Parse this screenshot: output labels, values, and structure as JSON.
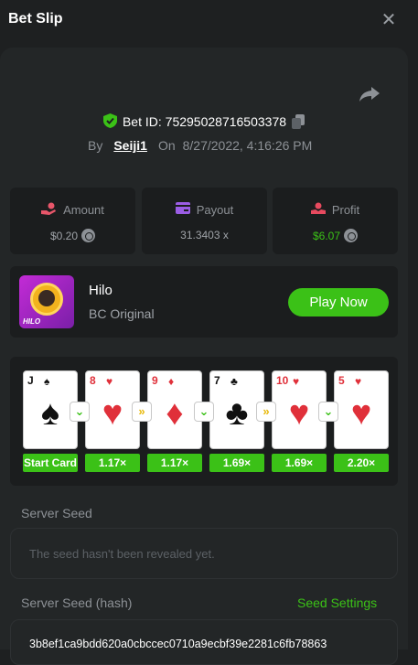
{
  "header": {
    "title": "Bet Slip",
    "close_glyph": "✕"
  },
  "bet": {
    "id_label": "Bet ID: 75295028716503378",
    "by_label": "By",
    "user": "Seiji1",
    "on_label": "On",
    "date": "8/27/2022, 4:16:26 PM"
  },
  "stats": {
    "amount": {
      "label": "Amount",
      "value": "$0.20",
      "icon": "hand-coins-icon",
      "icon_color": "#e8566a"
    },
    "payout": {
      "label": "Payout",
      "value": "31.3403 x",
      "icon": "card-icon",
      "icon_color": "#9b5de5"
    },
    "profit": {
      "label": "Profit",
      "value": "$6.07",
      "value_color": "#3bc117",
      "icon": "profit-icon",
      "icon_color": "#e84a5f"
    }
  },
  "game": {
    "name": "Hilo",
    "subtitle": "BC Original",
    "thumb_text": "HILO",
    "play_label": "Play Now"
  },
  "cards": [
    {
      "rank": "J",
      "suit": "♠",
      "color": "black",
      "mult": "Start Card"
    },
    {
      "rank": "8",
      "suit": "♥",
      "color": "red",
      "mult": "1.17×",
      "arrow": "green"
    },
    {
      "rank": "9",
      "suit": "♦",
      "color": "red",
      "mult": "1.17×",
      "arrow": "yellow"
    },
    {
      "rank": "7",
      "suit": "♣",
      "color": "black",
      "mult": "1.69×",
      "arrow": "green"
    },
    {
      "rank": "10",
      "suit": "♥",
      "color": "red",
      "mult": "1.69×",
      "arrow": "yellow"
    },
    {
      "rank": "5",
      "suit": "♥",
      "color": "red",
      "mult": "2.20×",
      "arrow": "green"
    }
  ],
  "seed": {
    "server_seed_label": "Server Seed",
    "server_seed_placeholder": "The seed hasn't been revealed yet.",
    "hash_label": "Server Seed (hash)",
    "settings_label": "Seed Settings",
    "hash_value": "3b8ef1ca9bdd620a0cbccec0710a9ecbf39e2281c6fb78863"
  },
  "colors": {
    "accent_green": "#3bc117",
    "panel": "#232627",
    "card_bg": "#1b1d1e"
  }
}
